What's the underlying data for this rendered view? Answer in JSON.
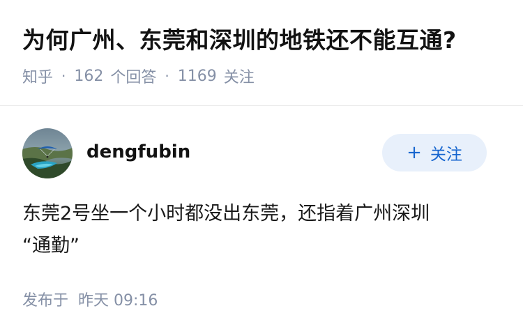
{
  "question": {
    "title": "为何广州、东莞和深圳的地铁还不能互通?",
    "source": "知乎",
    "answer_count": "162",
    "answer_label": "个回答",
    "follower_count": "1169",
    "follower_label": "关注",
    "separator": "·"
  },
  "answer": {
    "author": {
      "name": "dengfubin",
      "avatar_icon": "paraglider-coast-avatar"
    },
    "follow_button": {
      "icon": "+",
      "label": "关注"
    },
    "body_line_1": "东莞2号坐一个小时都没出东莞，还指着广州深圳",
    "body_line_2": "“通勤”",
    "time_label": "发布于",
    "time_value": "昨天 09:16"
  },
  "colors": {
    "meta_gray": "#8590a6",
    "follow_blue": "#1766cf",
    "follow_bg": "#e8f0fb",
    "text_dark": "#121212"
  }
}
